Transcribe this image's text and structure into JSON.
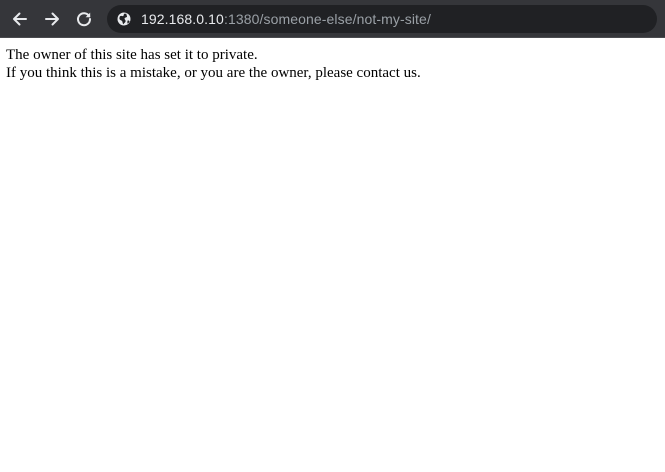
{
  "browser": {
    "address_bar": {
      "host": "192.168.0.10",
      "rest": ":1380/someone-else/not-my-site/"
    },
    "icons": {
      "back": "back-arrow-icon",
      "forward": "forward-arrow-icon",
      "reload": "reload-icon",
      "site_info": "globe-icon"
    },
    "colors": {
      "toolbar": "#35363a",
      "omnibox": "#202124",
      "url_host": "#e8eaed",
      "url_path": "#9aa0a6"
    }
  },
  "page": {
    "line1": "The owner of this site has set it to private.",
    "line2": "If you think this is a mistake, or you are the owner, please contact us."
  }
}
